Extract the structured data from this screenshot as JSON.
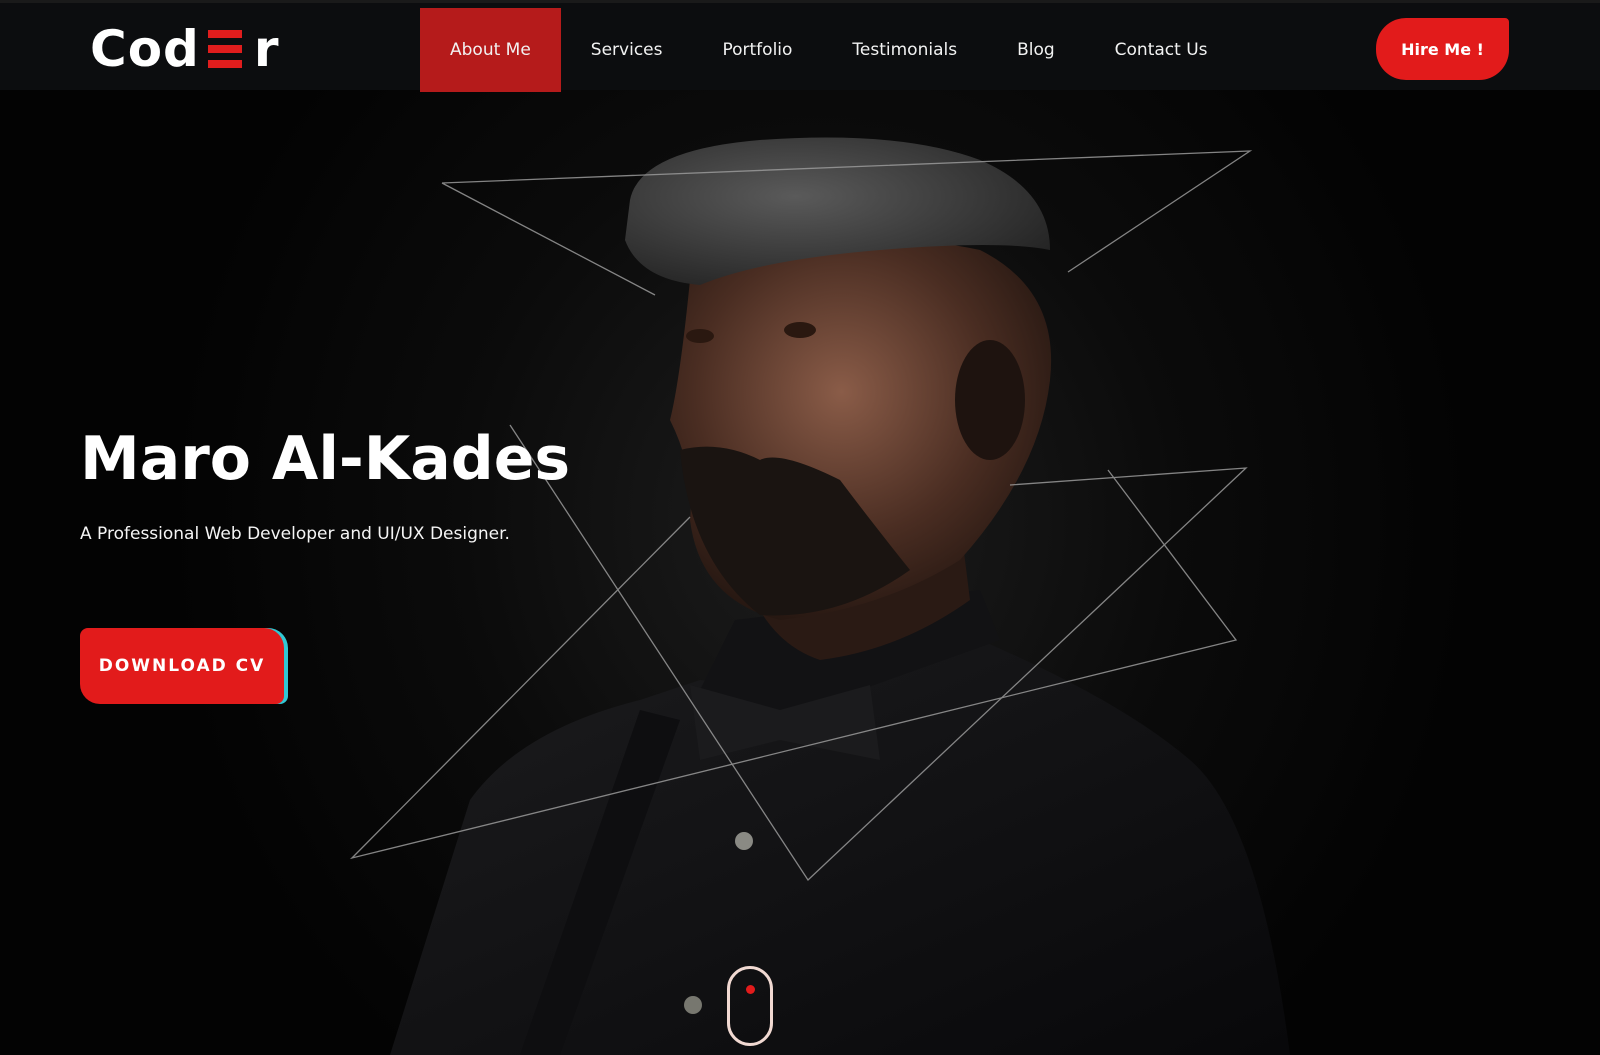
{
  "header": {
    "logo": {
      "prefix": "Cod",
      "suffix": "r",
      "bar_color": "#e01d1d",
      "icon": "triple-bar-e-icon"
    },
    "nav": [
      {
        "label": "About Me",
        "active": true
      },
      {
        "label": "Services",
        "active": false
      },
      {
        "label": "Portfolio",
        "active": false
      },
      {
        "label": "Testimonials",
        "active": false
      },
      {
        "label": "Blog",
        "active": false
      },
      {
        "label": "Contact Us",
        "active": false
      }
    ],
    "hire_label": "Hire Me !"
  },
  "hero": {
    "name": "Maro Al-Kades",
    "tagline": "A Professional Web Developer and UI/UX Designer.",
    "cta_label": "DOWNLOAD CV",
    "scroll_icon": "mouse-scroll-icon"
  },
  "colors": {
    "accent": "#e21b1b",
    "nav_active": "#b51b1b",
    "header_bg": "#0c0d0f",
    "cta_edge": "#31c8d4"
  }
}
